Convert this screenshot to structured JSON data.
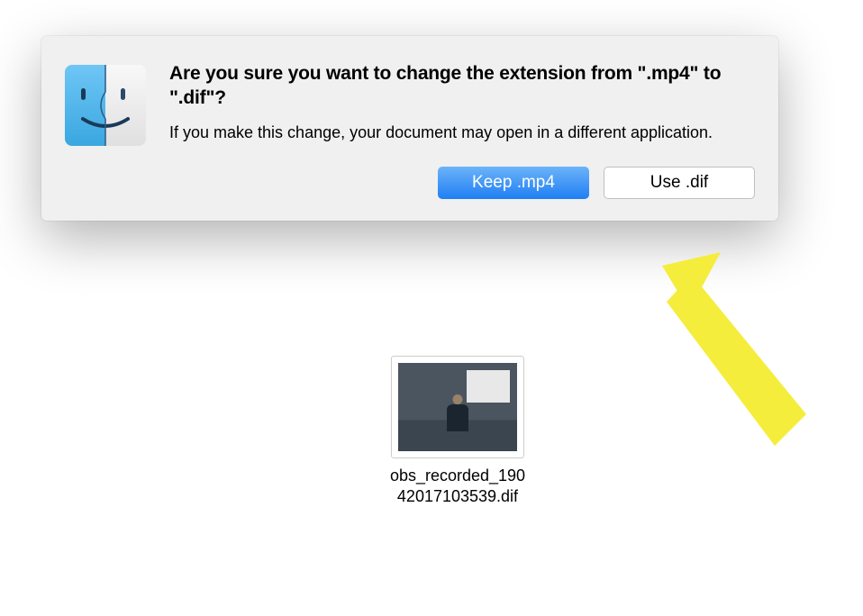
{
  "dialog": {
    "title": "Are you sure you want to change the extension from \".mp4\" to \".dif\"?",
    "message": "If you make this change, your document may open in a different application.",
    "primary_button_label": "Keep .mp4",
    "secondary_button_label": "Use .dif",
    "icon_name": "finder-icon"
  },
  "file": {
    "name_line1": "obs_recorded_190",
    "name_line2": "42017103539.dif"
  }
}
